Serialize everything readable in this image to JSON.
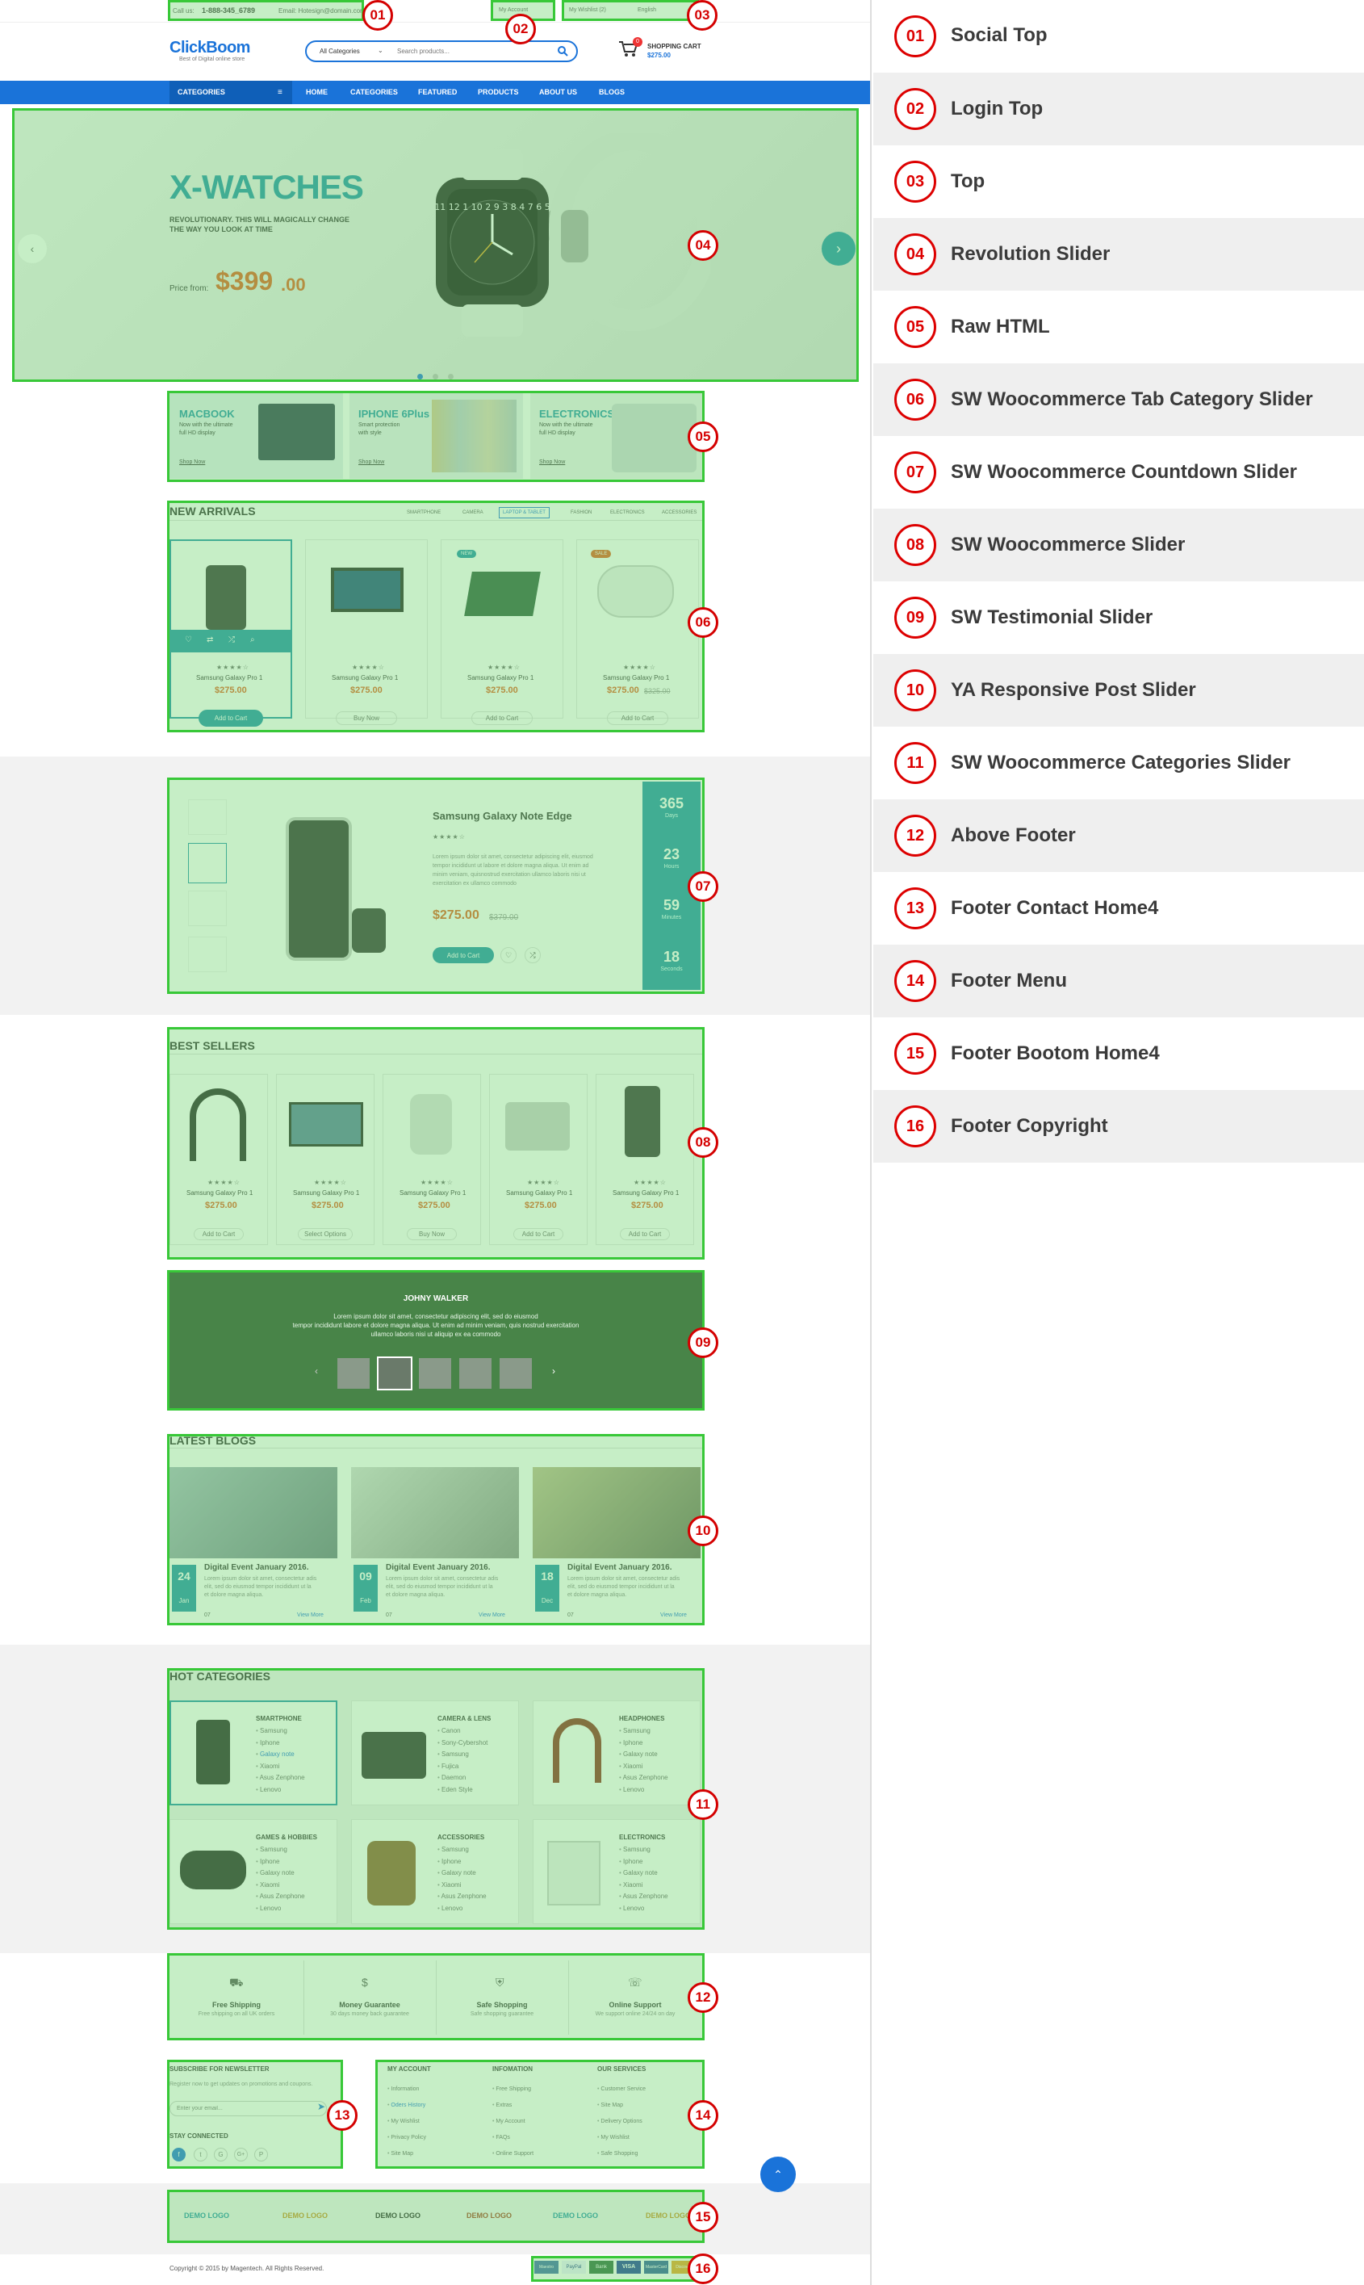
{
  "topbar": {
    "call_label": "Call us:",
    "phone": "1-888-345_6789",
    "email": "Email: Hotesign@domain.com",
    "account": "My Account",
    "wishlist": "My Wishlist (2)",
    "language": "English"
  },
  "header": {
    "logo": "ClickBoom",
    "tagline": "Best of Digital online store",
    "category_select": "All Categories",
    "search_placeholder": "Search products...",
    "cart_title": "SHOPPING CART",
    "cart_total": "$275.00",
    "cart_count": "0"
  },
  "nav": {
    "categories": "CATEGORIES",
    "links": [
      "HOME",
      "CATEGORIES",
      "FEATURED",
      "PRODUCTS",
      "ABOUT US",
      "BLOGS"
    ]
  },
  "slider": {
    "title": "X-WATCHES",
    "subtitle_1": "REVOLUTIONARY. THIS WILL MAGICALLY CHANGE",
    "subtitle_2": "THE WAY YOU LOOK AT TIME",
    "price_label": "Price from:",
    "price_main": "$399",
    "price_cents": ".00",
    "watch_face": "11 12 1 10 2 9 3 8 4 7 6 5"
  },
  "banners": [
    {
      "title": "MACBOOK",
      "line1": "Now with the ultimate",
      "line2": "full HD display",
      "link": "Shop Now"
    },
    {
      "title": "IPHONE 6Plus",
      "line1": "Smart protection",
      "line2": "with style",
      "link": "Shop Now"
    },
    {
      "title": "ELECTRONICS",
      "line1": "Now with the ultimate",
      "line2": "full HD display",
      "link": "Shop Now"
    }
  ],
  "new_arrivals": {
    "title": "NEW ARRIVALS",
    "tabs": [
      "SMARTPHONE",
      "CAMERA",
      "LAPTOP & TABLET",
      "FASHION",
      "ELECTRONICS",
      "ACCESSORIES"
    ],
    "products": [
      {
        "name": "Samsung Galaxy Pro 1",
        "price": "$275.00",
        "button": "Add to Cart",
        "badge": "",
        "old": ""
      },
      {
        "name": "Samsung Galaxy Pro 1",
        "price": "$275.00",
        "button": "Buy Now",
        "badge": "",
        "old": ""
      },
      {
        "name": "Samsung Galaxy Pro 1",
        "price": "$275.00",
        "button": "Add to Cart",
        "badge": "NEW",
        "old": ""
      },
      {
        "name": "Samsung Galaxy Pro 1",
        "price": "$275.00",
        "button": "Add to Cart",
        "badge": "SALE",
        "old": "$325.00"
      }
    ]
  },
  "countdown": {
    "name": "Samsung Galaxy Note Edge",
    "desc_1": "Lorem ipsum dolor sit amet, consectetur adipiscing elit, eiusmod",
    "desc_2": "tempor incididunt ut labore et dolore magna aliqua. Ut enim ad",
    "desc_3": "minim veniam, quisnostrud exercitation ullamco laboris nisi ut",
    "desc_4": "exercitation ex ullamco commodo",
    "price": "$275.00",
    "old_price": "$379.00",
    "button": "Add to Cart",
    "timer": [
      {
        "v": "365",
        "l": "Days"
      },
      {
        "v": "23",
        "l": "Hours"
      },
      {
        "v": "59",
        "l": "Minutes"
      },
      {
        "v": "18",
        "l": "Seconds"
      }
    ]
  },
  "best_sellers": {
    "title": "BEST SELLERS",
    "products": [
      {
        "name": "Samsung Galaxy Pro 1",
        "price": "$275.00",
        "button": "Add to Cart"
      },
      {
        "name": "Samsung Galaxy Pro 1",
        "price": "$275.00",
        "button": "Select Options"
      },
      {
        "name": "Samsung Galaxy Pro 1",
        "price": "$275.00",
        "button": "Buy Now"
      },
      {
        "name": "Samsung Galaxy Pro 1",
        "price": "$275.00",
        "button": "Add to Cart"
      },
      {
        "name": "Samsung Galaxy Pro 1",
        "price": "$275.00",
        "button": "Add to Cart"
      }
    ]
  },
  "testimonial": {
    "name": "JOHNY WALKER",
    "text_1": "Lorem ipsum dolor sit amet, consectetur adipiscing elit, sed do eiusmod",
    "text_2": "tempor incididunt labore et dolore magna aliqua. Ut enim ad minim veniam, quis nostrud exercitation",
    "text_3": "ullamco laboris nisi ut aliquip ex ea commodo"
  },
  "blogs": {
    "title": "LATEST BLOGS",
    "posts": [
      {
        "day": "24",
        "month": "Jan",
        "title": "Digital Event January 2016.",
        "l1": "Lorem ipsum dolor sit amet, consectetur adis",
        "l2": "elit, sed do eiusmod tempor incididunt ut la",
        "l3": "et dolore magna aliqua.",
        "comments": "07",
        "more": "View More"
      },
      {
        "day": "09",
        "month": "Feb",
        "title": "Digital Event January 2016.",
        "l1": "Lorem ipsum dolor sit amet, consectetur adis",
        "l2": "elit, sed do eiusmod tempor incididunt ut la",
        "l3": "et dolore magna aliqua.",
        "comments": "07",
        "more": "View More"
      },
      {
        "day": "18",
        "month": "Dec",
        "title": "Digital Event January 2016.",
        "l1": "Lorem ipsum dolor sit amet, consectetur adis",
        "l2": "elit, sed do eiusmod tempor incididunt ut la",
        "l3": "et dolore magna aliqua.",
        "comments": "07",
        "more": "View More"
      }
    ]
  },
  "hot_categories": {
    "title": "HOT CATEGORIES",
    "cats": [
      {
        "name": "SMARTPHONE",
        "items": [
          "Samsung",
          "Iphone",
          "Galaxy note",
          "Xiaomi",
          "Asus Zenphone",
          "Lenovo"
        ]
      },
      {
        "name": "CAMERA & LENS",
        "items": [
          "Canon",
          "Sony-Cybershot",
          "Samsung",
          "Fujica",
          "Daemon",
          "Eden Style"
        ]
      },
      {
        "name": "HEADPHONES",
        "items": [
          "Samsung",
          "Iphone",
          "Galaxy note",
          "Xiaomi",
          "Asus Zenphone",
          "Lenovo"
        ]
      },
      {
        "name": "GAMES & HOBBIES",
        "items": [
          "Samsung",
          "Iphone",
          "Galaxy note",
          "Xiaomi",
          "Asus Zenphone",
          "Lenovo"
        ]
      },
      {
        "name": "ACCESSORIES",
        "items": [
          "Samsung",
          "Iphone",
          "Galaxy note",
          "Xiaomi",
          "Asus Zenphone",
          "Lenovo"
        ]
      },
      {
        "name": "ELECTRONICS",
        "items": [
          "Samsung",
          "Iphone",
          "Galaxy note",
          "Xiaomi",
          "Asus Zenphone",
          "Lenovo"
        ]
      }
    ]
  },
  "services": [
    {
      "title": "Free Shipping",
      "desc": "Free shipping on all UK orders"
    },
    {
      "title": "Money Guarantee",
      "desc": "30 days money back guarantee"
    },
    {
      "title": "Safe Shopping",
      "desc": "Safe shopping guarantee"
    },
    {
      "title": "Online Support",
      "desc": "We support online 24/24 on day"
    }
  ],
  "newsletter": {
    "title": "SUBSCRIBE FOR NEWSLETTER",
    "desc": "Register now to get updates on promotions and coupons.",
    "placeholder": "Enter your email...",
    "stay": "STAY CONNECTED",
    "socials": [
      "f",
      "t",
      "G",
      "G+",
      "P"
    ]
  },
  "footer_menu": [
    {
      "title": "MY ACCOUNT",
      "items": [
        "Information",
        "Oders History",
        "My Wishlist",
        "Privacy Policy",
        "Site Map"
      ]
    },
    {
      "title": "INFOMATION",
      "items": [
        "Free Shipping",
        "Extras",
        "My Account",
        "FAQs",
        "Online Support"
      ]
    },
    {
      "title": "OUR SERVICES",
      "items": [
        "Customer Service",
        "Site Map",
        "Delivery Options",
        "My Wishlist",
        "Safe Shopping"
      ]
    }
  ],
  "logos": [
    "DEMO LOGO",
    "DEMO LOGO",
    "DEMO LOGO",
    "DEMO LOGO",
    "DEMO LOGO",
    "DEMO LOGO"
  ],
  "copyright": "Copyright © 2015 by Magentech. All Rights Reserved.",
  "payments": [
    "Maestro",
    "PayPal",
    "Bank",
    "VISA",
    "MasterCard",
    "Discover"
  ],
  "legend": [
    {
      "n": "01",
      "label": "Social Top"
    },
    {
      "n": "02",
      "label": "Login Top"
    },
    {
      "n": "03",
      "label": "Top"
    },
    {
      "n": "04",
      "label": "Revolution Slider"
    },
    {
      "n": "05",
      "label": "Raw HTML"
    },
    {
      "n": "06",
      "label": "SW Woocommerce Tab Category Slider"
    },
    {
      "n": "07",
      "label": "SW Woocommerce Countdown Slider"
    },
    {
      "n": "08",
      "label": "SW Woocommerce Slider"
    },
    {
      "n": "09",
      "label": "SW Testimonial Slider"
    },
    {
      "n": "10",
      "label": "YA Responsive Post Slider"
    },
    {
      "n": "11",
      "label": "SW Woocommerce Categories Slider"
    },
    {
      "n": "12",
      "label": "Above Footer"
    },
    {
      "n": "13",
      "label": "Footer Contact Home4"
    },
    {
      "n": "14",
      "label": "Footer Menu"
    },
    {
      "n": "15",
      "label": "Footer Bootom Home4"
    },
    {
      "n": "16",
      "label": "Footer Copyright"
    }
  ],
  "colors": {
    "brand_blue": "#1a73d9",
    "teal": "#1a8fa8",
    "orange": "#e05a1a",
    "overlay_green": "#38c838",
    "marker_red": "#d40000"
  }
}
